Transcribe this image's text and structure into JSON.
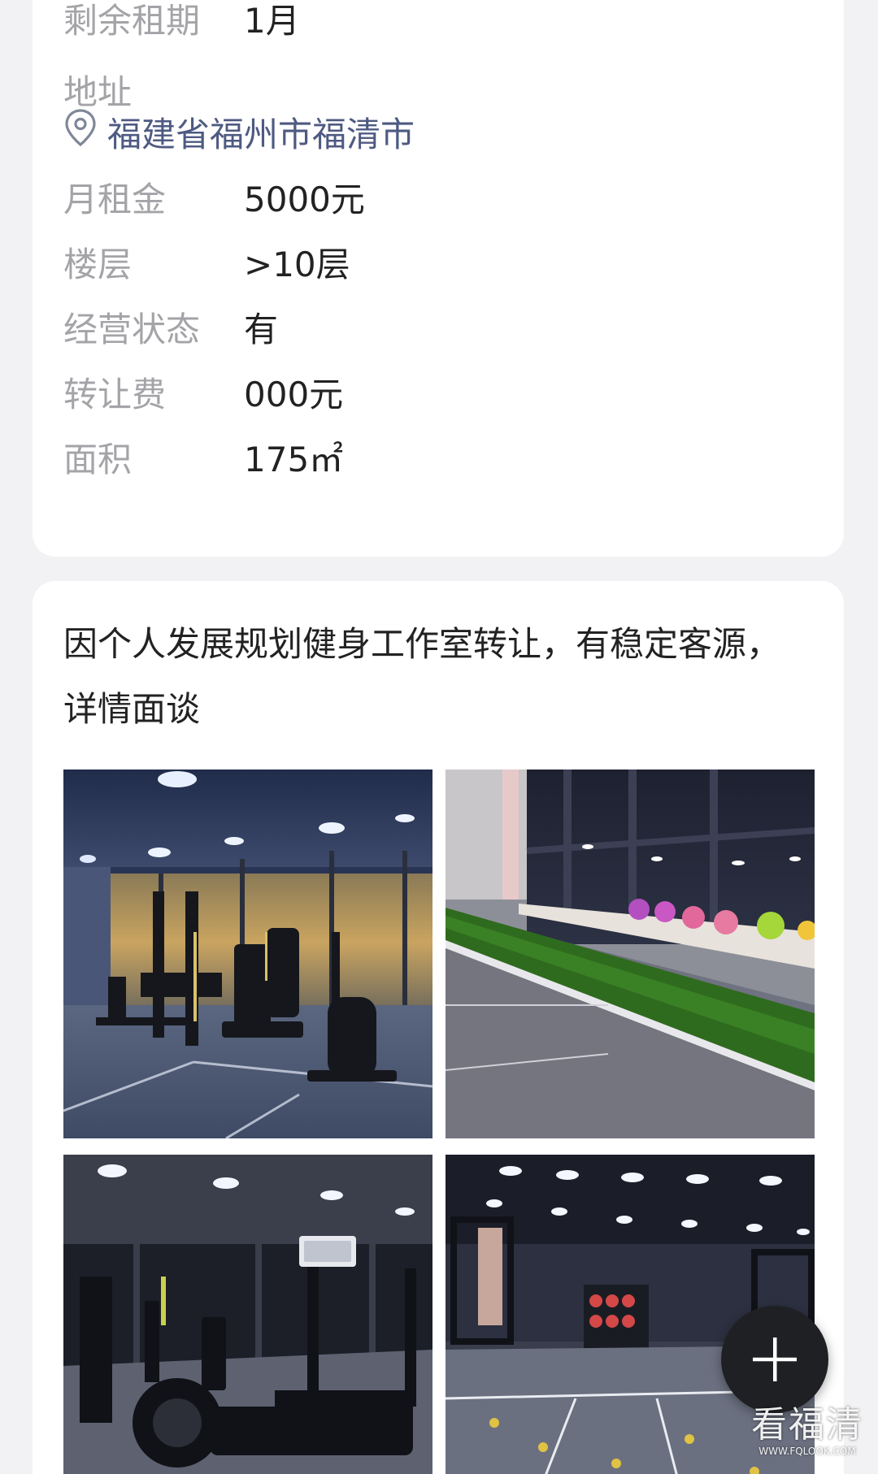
{
  "info": {
    "remaining_lease": {
      "label": "剩余租期",
      "value": "1月"
    },
    "address_label": "地址",
    "address_value": "福建省福州市福清市",
    "monthly_rent": {
      "label": "月租金",
      "value": "5000元"
    },
    "floor": {
      "label": "楼层",
      "value": ">10层"
    },
    "operating_status": {
      "label": "经营状态",
      "value": "有"
    },
    "transfer_fee": {
      "label": "转让费",
      "value": "000元"
    },
    "area": {
      "label": "面积",
      "value": "175㎡"
    }
  },
  "description": {
    "text": "因个人发展规划健身工作室转让，有稳定客源，详情面谈"
  },
  "watermark": {
    "main": "看福清",
    "sub": "WWW.FQLOOK.COM"
  },
  "colors": {
    "background": "#f2f2f4",
    "card": "#ffffff",
    "label": "#a4a4a8",
    "value": "#222222",
    "address_link": "#4e5a82",
    "fab": "#1f2023"
  },
  "icons": {
    "location": "location-pin-icon",
    "fab": "plus-icon"
  }
}
